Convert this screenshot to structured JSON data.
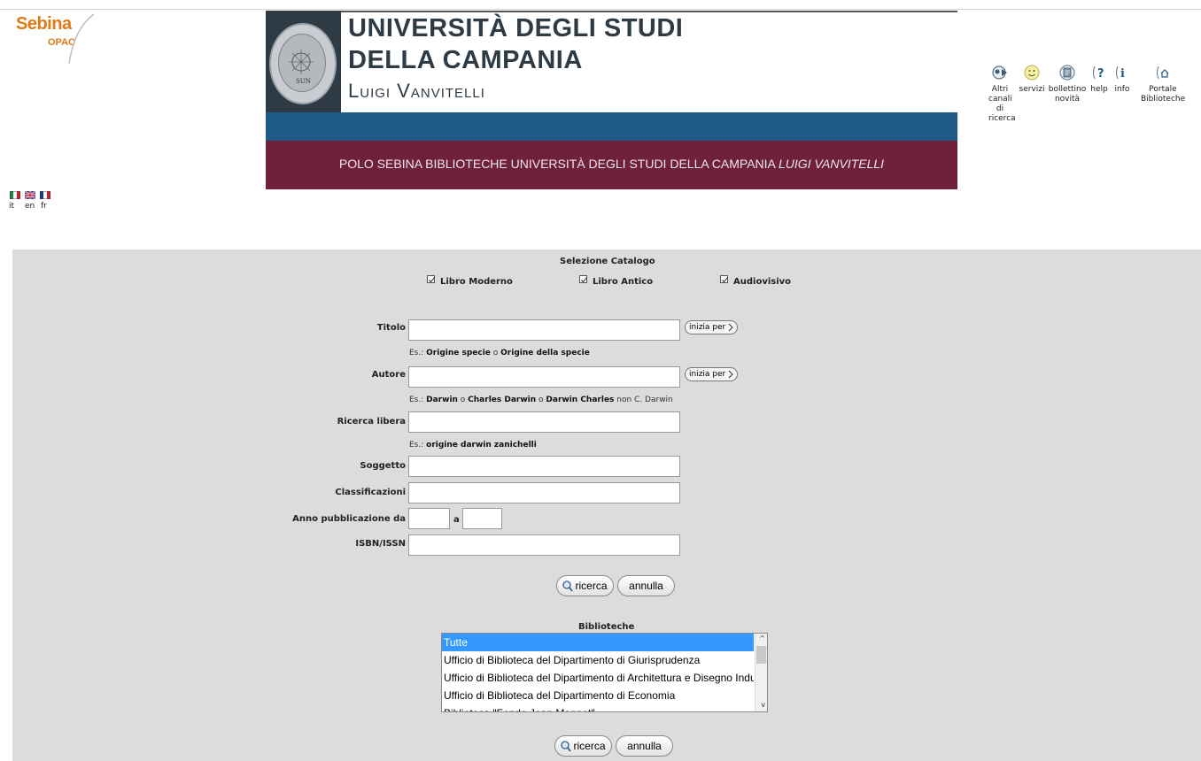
{
  "logo": {
    "name": "Sebina",
    "sub": "OPAC"
  },
  "banner": {
    "line1": "UNIVERSITÀ DEGLI STUDI",
    "line2": "DELLA CAMPANIA",
    "line3": "Luigi Vanvitelli",
    "seal_text": "SUN",
    "polo_text": "POLO SEBINA BIBLIOTECHE UNIVERSITÀ DEGLI STUDI DELLA CAMPANIA",
    "polo_italic": "LUIGI VANVITELLI"
  },
  "tools": {
    "altri": [
      "Altri",
      "canali",
      "di",
      "ricerca"
    ],
    "servizi": "servizi",
    "bollettino": [
      "bollettino",
      "novità"
    ],
    "help": "help",
    "info": "info",
    "portale": [
      "Portale",
      "Biblioteche"
    ]
  },
  "languages": [
    "it",
    "en",
    "fr"
  ],
  "catalog": {
    "title": "Selezione Catalogo",
    "options": [
      {
        "label": "Libro Moderno",
        "checked": true
      },
      {
        "label": "Libro Antico",
        "checked": true
      },
      {
        "label": "Audiovisivo",
        "checked": true
      }
    ]
  },
  "form": {
    "titolo_label": "Titolo",
    "titolo_value": "",
    "inizia_per": "inizia per",
    "titolo_hint": {
      "prefix": "Es.: ",
      "a": "Origine specie",
      "sep": " o ",
      "b": "Origine della specie"
    },
    "autore_label": "Autore",
    "autore_value": "",
    "autore_hint": {
      "prefix": "Es.: ",
      "a": "Darwin",
      "o1": " o ",
      "b": "Charles Darwin",
      "o2": " o ",
      "c": "Darwin Charles",
      "non": " non C. Darwin"
    },
    "libera_label": "Ricerca libera",
    "libera_value": "",
    "libera_hint": {
      "prefix": "Es.: ",
      "a": "origine darwin zanichelli"
    },
    "soggetto_label": "Soggetto",
    "class_label": "Classificazioni",
    "anno_label": "Anno pubblicazione da",
    "anno_a": "a",
    "isbn_label": "ISBN/ISSN"
  },
  "buttons": {
    "ricerca": "ricerca",
    "annulla": "annulla"
  },
  "biblioteche": {
    "title": "Biblioteche",
    "items": [
      "Tutte",
      "Ufficio di Biblioteca del Dipartimento di Giurisprudenza",
      "Ufficio di Biblioteca del Dipartimento di Architettura e Disegno Industriale",
      "Ufficio di Biblioteca del Dipartimento di Economia",
      "Biblioteca \"Fondo Jean Monnet\""
    ],
    "selected_index": 0
  }
}
